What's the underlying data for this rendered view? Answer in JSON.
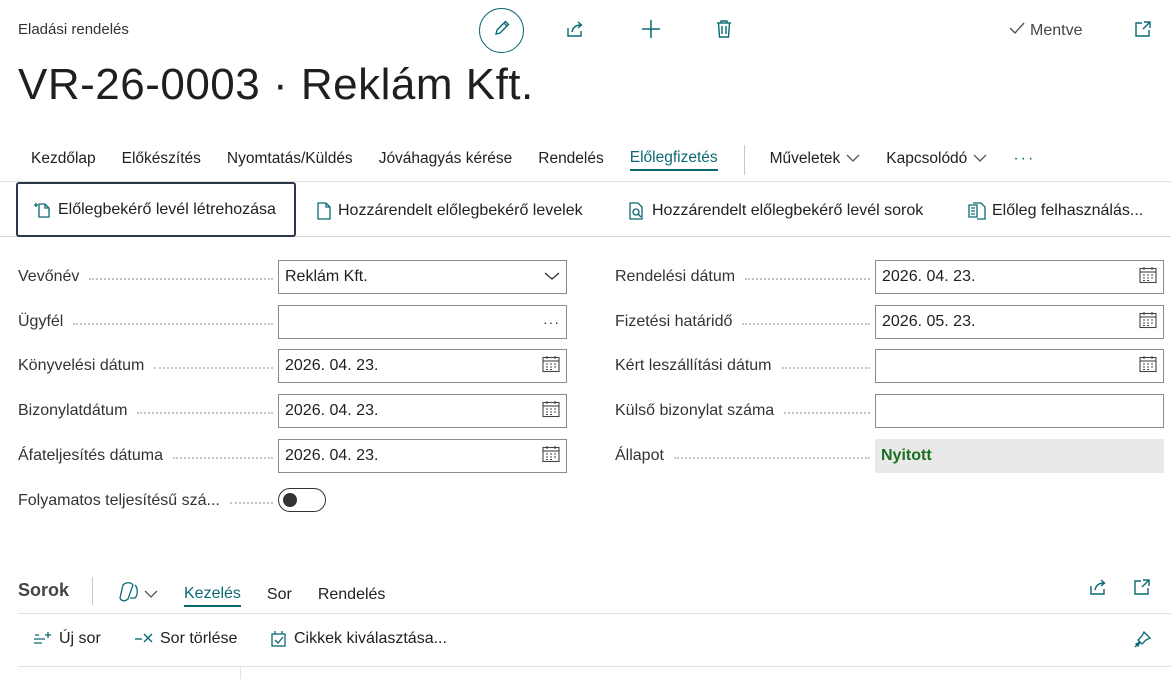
{
  "header": {
    "page_type": "Eladási rendelés",
    "title": "VR-26-0003 · Reklám Kft.",
    "saved_label": "Mentve"
  },
  "action_tabs": [
    {
      "label": "Kezdőlap"
    },
    {
      "label": "Előkészítés"
    },
    {
      "label": "Nyomtatás/Küldés"
    },
    {
      "label": "Jóváhagyás kérése"
    },
    {
      "label": "Rendelés"
    },
    {
      "label": "Előlegfizetés",
      "active": true
    }
  ],
  "action_dropdowns": [
    {
      "label": "Műveletek"
    },
    {
      "label": "Kapcsolódó"
    }
  ],
  "more_label": "···",
  "sub_actions": [
    {
      "label": "Előlegbekérő levél létrehozása"
    },
    {
      "label": "Hozzárendelt előlegbekérő levelek"
    },
    {
      "label": "Hozzárendelt előlegbekérő levél sorok"
    },
    {
      "label": "Előleg felhasználás..."
    }
  ],
  "fields_left": [
    {
      "label": "Vevőnév",
      "value": "Reklám Kft."
    },
    {
      "label": "Ügyfél",
      "value": ""
    },
    {
      "label": "Könyvelési dátum",
      "value": "2026. 04. 23."
    },
    {
      "label": "Bizonylatdátum",
      "value": "2026. 04. 23."
    },
    {
      "label": "Áfateljesítés dátuma",
      "value": "2026. 04. 23."
    },
    {
      "label": "Folyamatos teljesítésű szá...",
      "value": ""
    }
  ],
  "fields_right": [
    {
      "label": "Rendelési dátum",
      "value": "2026. 04. 23."
    },
    {
      "label": "Fizetési határidő",
      "value": "2026. 05. 23."
    },
    {
      "label": "Kért leszállítási dátum",
      "value": ""
    },
    {
      "label": "Külső bizonylat száma",
      "value": ""
    },
    {
      "label": "Állapot",
      "value": "Nyitott"
    }
  ],
  "lines": {
    "title": "Sorok",
    "tabs": [
      {
        "label": "Kezelés",
        "active": true
      },
      {
        "label": "Sor"
      },
      {
        "label": "Rendelés"
      }
    ],
    "actions": [
      {
        "label": "Új sor"
      },
      {
        "label": "Sor törlése"
      },
      {
        "label": "Cikkek kiválasztása..."
      }
    ]
  },
  "colors": {
    "accent": "#0a6a74",
    "status_green": "#197021",
    "focus_border": "#2b3646"
  }
}
